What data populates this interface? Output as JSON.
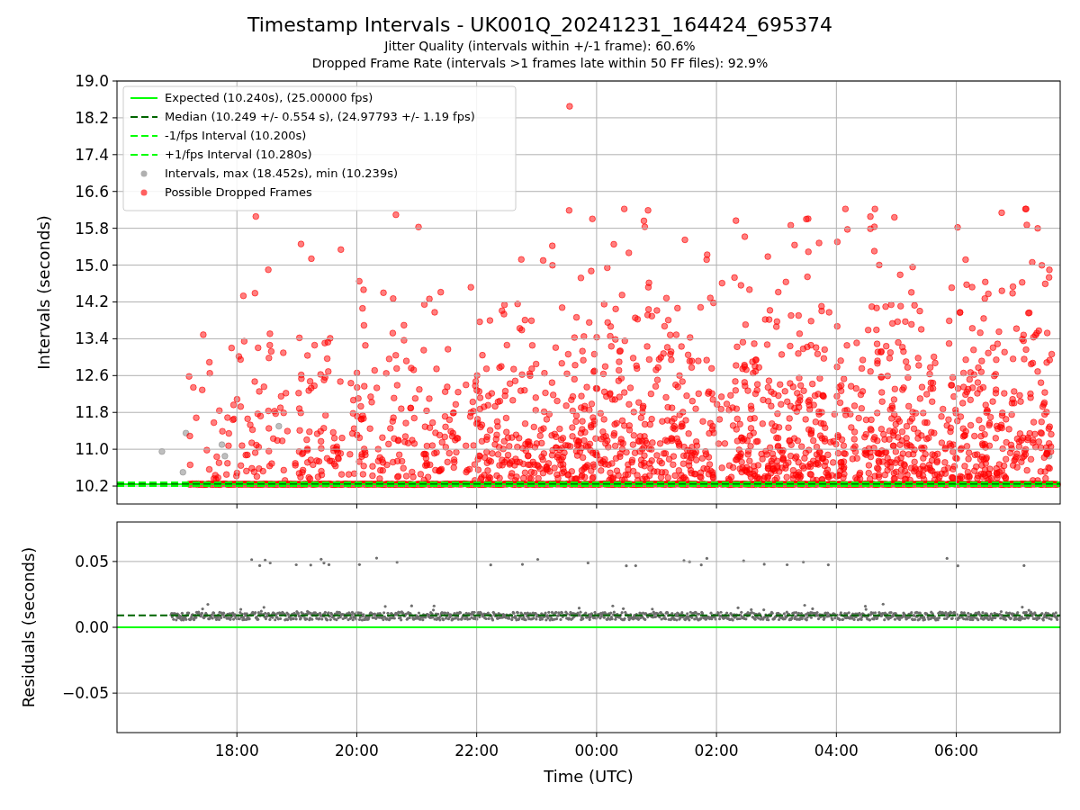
{
  "figure": {
    "title": "Timestamp Intervals - UK001Q_20241231_164424_695374",
    "subtitles": [
      "Jitter Quality (intervals within +/-1 frame): 60.6%",
      "Dropped Frame Rate (intervals >1 frames late within 50 FF files): 92.9%"
    ],
    "top_plot": {
      "chart_data": {
        "type": "line",
        "ylabel": "Intervals (seconds)",
        "grid": true,
        "legend": true,
        "x": [
          "2024-12-31 16:00",
          "2025-01-01 07:44"
        ],
        "xlim": [
          "2024-12-31 16:00",
          "2025-01-01 07:44"
        ],
        "ylim": [
          9.81,
          19.0
        ],
        "yticks": [
          {
            "value": 10.2,
            "label": "10.2"
          },
          {
            "value": 11.0,
            "label": "11.0"
          },
          {
            "value": 11.8,
            "label": "11.8"
          },
          {
            "value": 12.6,
            "label": "12.6"
          },
          {
            "value": 13.4,
            "label": "13.4"
          },
          {
            "value": 14.2,
            "label": "14.2"
          },
          {
            "value": 15.0,
            "label": "15.0"
          },
          {
            "value": 15.8,
            "label": "15.8"
          },
          {
            "value": 16.6,
            "label": "16.6"
          },
          {
            "value": 17.4,
            "label": "17.4"
          },
          {
            "value": 18.2,
            "label": "18.2"
          },
          {
            "value": 19.0,
            "label": "19.0"
          }
        ],
        "series": [
          {
            "name": "Expected (10.240s), (25.00000 fps)",
            "color": "#00ff00",
            "line_style": "solid",
            "values": [
              10.24,
              10.24
            ]
          },
          {
            "name": "Median (10.249 +/- 0.554 s), (24.97793 +/- 1.19 fps)",
            "color": "#006400",
            "line_style": "dashed",
            "values": [
              10.249,
              10.249
            ]
          },
          {
            "name": "-1/fps Interval (10.200s)",
            "color": "#00ff00",
            "line_style": "dashed",
            "values": [
              10.2,
              10.2
            ]
          },
          {
            "name": "+1/fps Interval (10.280s)",
            "color": "#00ff00",
            "line_style": "dashed",
            "values": [
              10.28,
              10.28
            ]
          }
        ]
      },
      "point_legend": [
        {
          "label": "Intervals, max (18.452s), min (10.239s)",
          "color": "#b0b0b0"
        },
        {
          "label": "Possible Dropped Frames",
          "color": "#ff6060"
        }
      ]
    },
    "bottom_plot": {
      "chart_data": {
        "type": "line",
        "ylabel": "Residuals (seconds)",
        "xlabel": "Time (UTC)",
        "grid": true,
        "x": [
          "2024-12-31 16:00",
          "2025-01-01 07:44"
        ],
        "xlim": [
          "2024-12-31 16:00",
          "2025-01-01 07:44"
        ],
        "ylim": [
          -0.08,
          0.08
        ],
        "xticks": [
          {
            "value": "2024-12-31 18:00",
            "label": "18:00"
          },
          {
            "value": "2024-12-31 20:00",
            "label": "20:00"
          },
          {
            "value": "2024-12-31 22:00",
            "label": "22:00"
          },
          {
            "value": "2025-01-01 00:00",
            "label": "00:00"
          },
          {
            "value": "2025-01-01 02:00",
            "label": "02:00"
          },
          {
            "value": "2025-01-01 04:00",
            "label": "04:00"
          },
          {
            "value": "2025-01-01 06:00",
            "label": "06:00"
          }
        ],
        "yticks": [
          {
            "value": 0.05,
            "label": "0.05"
          },
          {
            "value": 0.0,
            "label": "0.00"
          },
          {
            "value": -0.05,
            "label": "−0.05"
          }
        ],
        "series": [
          {
            "color": "#00ff00",
            "line_style": "solid",
            "values": [
              0.0,
              0.0
            ]
          },
          {
            "color": "#006400",
            "line_style": "dashed",
            "values": [
              0.009,
              0.009
            ]
          }
        ]
      }
    }
  }
}
